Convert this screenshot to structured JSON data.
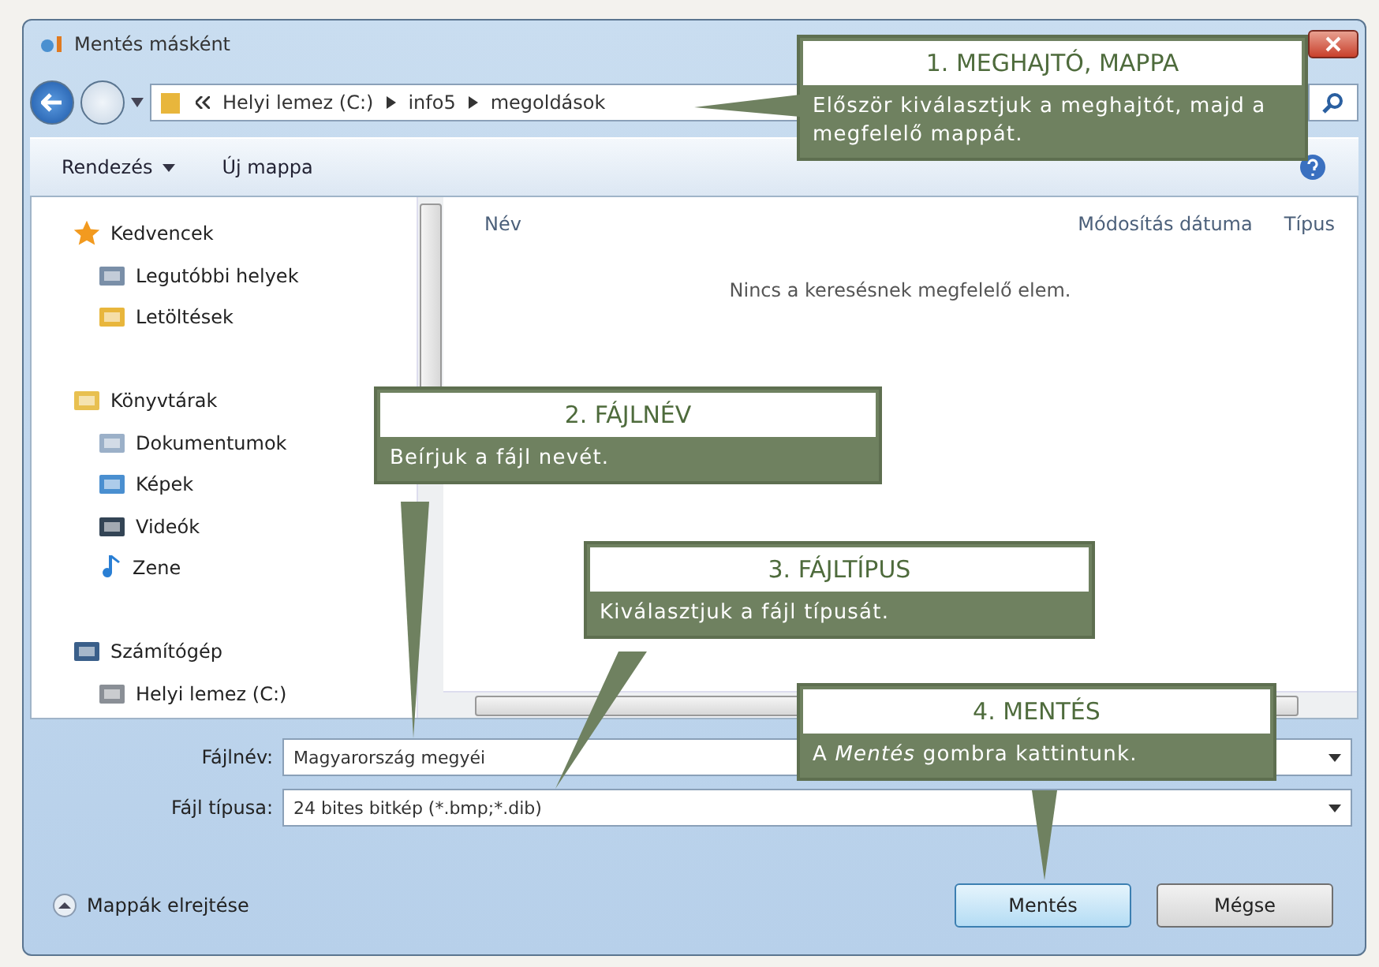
{
  "window": {
    "title": "Mentés másként"
  },
  "address": {
    "segments": [
      "Helyi lemez (C:)",
      "info5",
      "megoldások"
    ]
  },
  "toolbar": {
    "items": [
      {
        "label": "Rendezés",
        "dropdown": true
      },
      {
        "label": "Új mappa",
        "dropdown": false
      }
    ]
  },
  "sidebar": {
    "groups": [
      {
        "label": "Kedvencek",
        "kind": "star",
        "children": [
          {
            "label": "Legutóbbi helyek",
            "kind": "recent"
          },
          {
            "label": "Letöltések",
            "kind": "download"
          }
        ]
      },
      {
        "label": "Könyvtárak",
        "kind": "library",
        "children": [
          {
            "label": "Dokumentumok",
            "kind": "document"
          },
          {
            "label": "Képek",
            "kind": "image"
          },
          {
            "label": "Videók",
            "kind": "film"
          },
          {
            "label": "Zene",
            "kind": "music"
          }
        ]
      },
      {
        "label": "Számítógép",
        "kind": "computer",
        "children": [
          {
            "label": "Helyi lemez (C:)",
            "kind": "drive"
          }
        ]
      }
    ]
  },
  "file_list": {
    "columns": [
      "Név",
      "Módosítás dátuma",
      "Típus"
    ],
    "empty_message": "Nincs a keresésnek megfelelő elem."
  },
  "fields": [
    {
      "label": "Fájlnév:",
      "value": "Magyarország megyéi"
    },
    {
      "label": "Fájl típusa:",
      "value": "24 bites bitkép (*.bmp;*.dib)"
    }
  ],
  "hide_folders": "Mappák elrejtése",
  "buttons": [
    {
      "label": "Mentés",
      "default": true
    },
    {
      "label": "Mégse",
      "default": false
    }
  ],
  "callouts": [
    {
      "title": "1. MEGHAJTÓ, MAPPA",
      "body": "Először kiválasztjuk a meghajtót, majd a megfelelő mappát."
    },
    {
      "title": "2. FÁJLNÉV",
      "body": "Beírjuk a fájl nevét."
    },
    {
      "title": "3. FÁJLTÍPUS",
      "body": "Kiválasztjuk a fájl típusát."
    },
    {
      "title": "4. MENTÉS",
      "body": "A *Mentés* gombra kattintunk."
    }
  ]
}
